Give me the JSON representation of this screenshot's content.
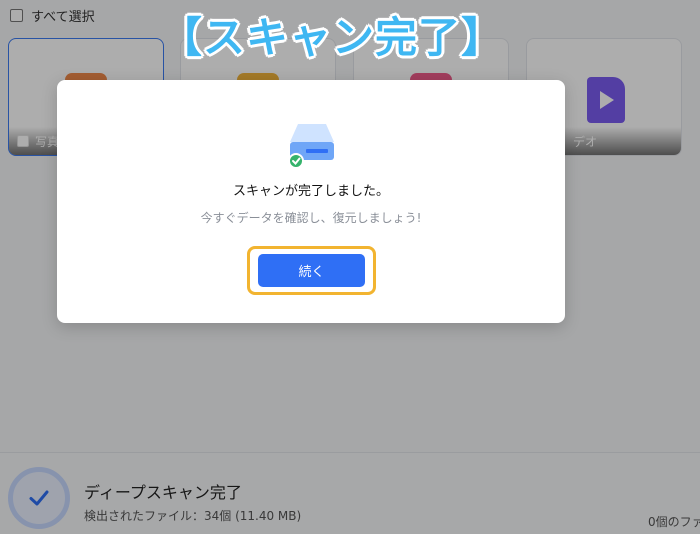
{
  "annotation": {
    "text": "【スキャン完了】"
  },
  "toolbar": {
    "select_all_label": "すべて選択"
  },
  "cards": [
    {
      "label": "写真",
      "icon": "photo-icon",
      "color": "#f08a4b"
    },
    {
      "label": "",
      "icon": "document-icon",
      "color": "#f2b43c"
    },
    {
      "label": "",
      "icon": "music-icon",
      "color": "#ef5b8a"
    },
    {
      "label": "デオ",
      "icon": "video-icon",
      "color": "#7b5cf0"
    }
  ],
  "dialog": {
    "icon": "drive-check-icon",
    "title": "スキャンが完了しました。",
    "subtitle": "今すぐデータを確認し、復元しましょう!",
    "continue_label": "続く",
    "accent": "#2f6ff5",
    "highlight": "#f2b430"
  },
  "status": {
    "title": "ディープスキャン完了",
    "detected": "検出されたファイル：34個 (11.40 MB)",
    "right_text": "0個のファ"
  }
}
